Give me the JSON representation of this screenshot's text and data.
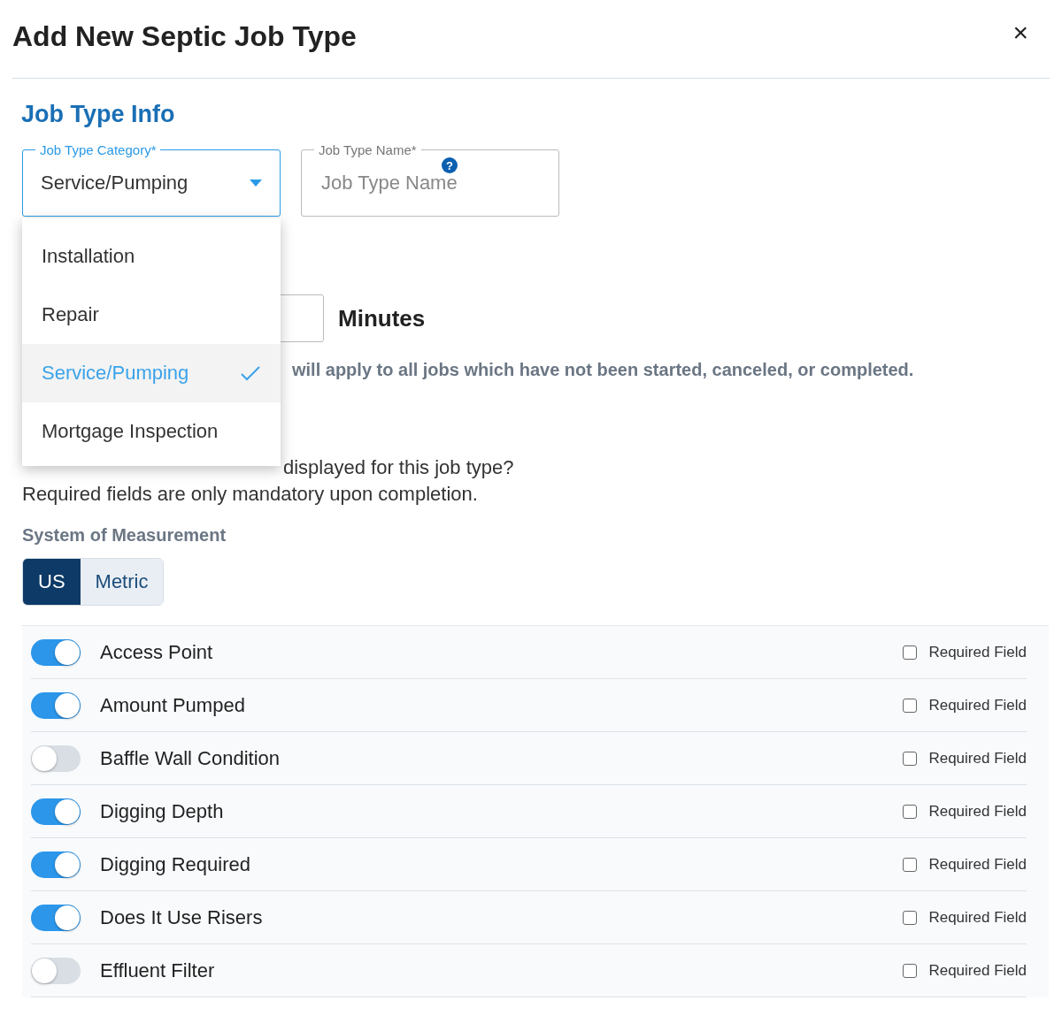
{
  "dialog": {
    "title": "Add New Septic Job Type",
    "close": "×"
  },
  "section_title": "Job Type Info",
  "category_field": {
    "label": "Job Type Category*",
    "value": "Service/Pumping",
    "expanded": true,
    "options": [
      {
        "label": "Installation",
        "selected": false
      },
      {
        "label": "Repair",
        "selected": false
      },
      {
        "label": "Service/Pumping",
        "selected": true
      },
      {
        "label": "Mortgage Inspection",
        "selected": false
      }
    ]
  },
  "name_field": {
    "label": "Job Type Name*",
    "help": "?",
    "placeholder": "Job Type Name"
  },
  "duration": {
    "unit": "Minutes"
  },
  "notice": "will apply to all jobs which have not been started, canceled, or completed.",
  "question_tail": "displayed for this job type?",
  "hint": "Required fields are only mandatory upon completion.",
  "measurement": {
    "label": "System of Measurement",
    "options": [
      {
        "label": "US",
        "selected": true
      },
      {
        "label": "Metric",
        "selected": false
      }
    ]
  },
  "fields": [
    {
      "name": "Access Point",
      "on": true,
      "required": false,
      "required_label": "Required Field"
    },
    {
      "name": "Amount Pumped",
      "on": true,
      "required": false,
      "required_label": "Required Field"
    },
    {
      "name": "Baffle Wall Condition",
      "on": false,
      "required": false,
      "required_label": "Required Field"
    },
    {
      "name": "Digging Depth",
      "on": true,
      "required": false,
      "required_label": "Required Field"
    },
    {
      "name": "Digging Required",
      "on": true,
      "required": false,
      "required_label": "Required Field"
    },
    {
      "name": "Does It Use Risers",
      "on": true,
      "required": false,
      "required_label": "Required Field"
    },
    {
      "name": "Effluent Filter",
      "on": false,
      "required": false,
      "required_label": "Required Field"
    }
  ]
}
